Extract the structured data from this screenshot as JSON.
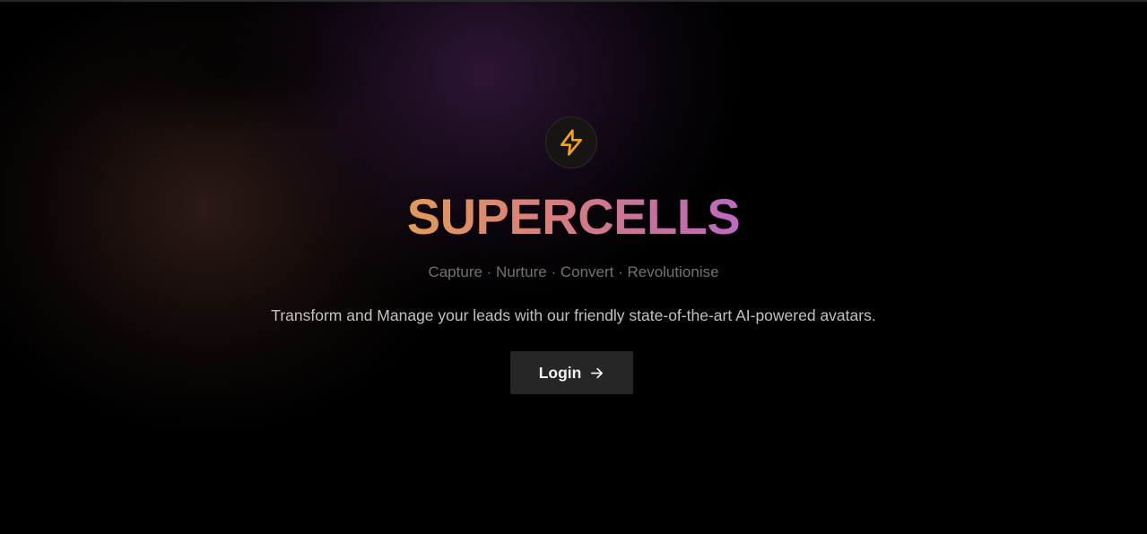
{
  "hero": {
    "icon": "lightning-bolt-icon",
    "title": "SUPERCELLS",
    "tagline": "Capture · Nurture · Convert · Revolutionise",
    "description": "Transform and Manage your leads with our friendly state-of-the-art AI-powered avatars.",
    "login_label": "Login",
    "login_icon": "arrow-right-icon"
  },
  "colors": {
    "background": "#000000",
    "icon_accent": "#f2a31b",
    "title_gradient_start": "#e29a59",
    "title_gradient_end": "#bd6ac2",
    "button_background": "#262626"
  }
}
